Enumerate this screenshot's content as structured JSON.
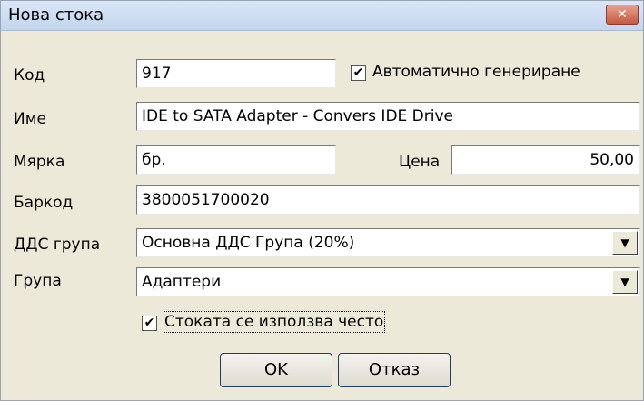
{
  "window": {
    "title": "Нова стока",
    "close_glyph": "✕"
  },
  "form": {
    "code": {
      "label": "Код",
      "value": "917"
    },
    "auto_generate": {
      "label": "Автоматично генериране",
      "checked": true
    },
    "name": {
      "label": "Име",
      "value": "IDE to SATA Adapter - Convers IDE Drive"
    },
    "unit": {
      "label": "Мярка",
      "value": "бр."
    },
    "price": {
      "label": "Цена",
      "value": "50,00"
    },
    "barcode": {
      "label": "Баркод",
      "value": "3800051700020"
    },
    "vat_group": {
      "label": "ДДС група",
      "value": "Основна ДДС Група (20%)"
    },
    "group": {
      "label": "Група",
      "value": "Адаптери"
    },
    "frequent": {
      "label": "Стоката се използва често",
      "checked": true
    }
  },
  "buttons": {
    "ok": "OK",
    "cancel": "Отказ"
  },
  "glyphs": {
    "check": "✔",
    "dropdown": "▼"
  }
}
